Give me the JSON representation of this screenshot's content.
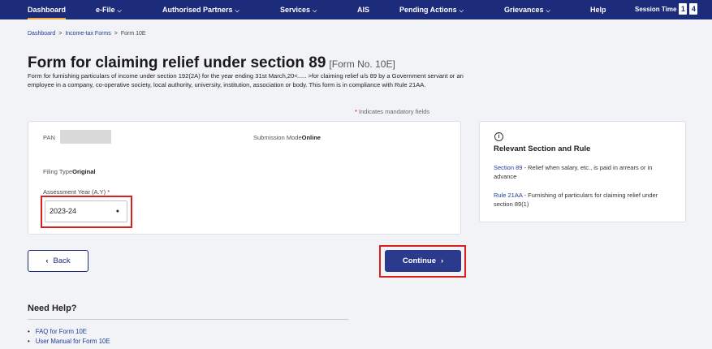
{
  "nav": {
    "items": [
      {
        "label": "Dashboard",
        "dropdown": false,
        "active": true
      },
      {
        "label": "e-File",
        "dropdown": true
      },
      {
        "label": "Authorised Partners",
        "dropdown": true
      },
      {
        "label": "Services",
        "dropdown": true
      },
      {
        "label": "AIS",
        "dropdown": false
      },
      {
        "label": "Pending Actions",
        "dropdown": true
      },
      {
        "label": "Grievances",
        "dropdown": true
      },
      {
        "label": "Help",
        "dropdown": false
      }
    ],
    "session_label": "Session Time",
    "session_digits": [
      "1",
      "4"
    ]
  },
  "breadcrumb": {
    "items": [
      "Dashboard",
      "Income-tax Forms",
      "Form 10E"
    ],
    "separator": ">"
  },
  "page": {
    "title": "Form for claiming relief under section 89",
    "form_no": "[Form No. 10E]",
    "description": "Form for furnishing particulars of income under section 192(2A) for the year ending 31st March,20<..... >for claiming relief u/s 89 by a Government servant or an employee in a company, co-operative society, local authority, university, institution, association or body. This form is in compliance with Rule 21AA.",
    "mandatory_star": "*",
    "mandatory_note": "Indicates mandatory fields"
  },
  "form": {
    "pan_label": "PAN",
    "submission_mode_label": "Submission Mode",
    "submission_mode_value": "Online",
    "filing_type_label": "Filing Type",
    "filing_type_value": "Original",
    "ay_label": "Assessment Year (A.Y)",
    "ay_required": "*",
    "ay_value": "2023-24"
  },
  "side": {
    "title": "Relevant Section and Rule",
    "items": [
      {
        "link": "Section 89",
        "text": " - Relief when salary, etc., is paid in arrears or in advance"
      },
      {
        "link": "Rule 21AA",
        "text": " - Furnishing of particulars for claiming relief under section 89(1)"
      }
    ]
  },
  "buttons": {
    "back_icon": "‹",
    "back": "Back",
    "continue": "Continue",
    "continue_icon": "›"
  },
  "help": {
    "title": "Need Help?",
    "links": [
      "FAQ for Form 10E",
      "User Manual for Form 10E"
    ]
  },
  "colors": {
    "nav_bg": "#1c2b7a",
    "primary": "#2b3a8c",
    "link": "#1c3f9c",
    "highlight": "#d9201c",
    "required": "#dd0000"
  }
}
